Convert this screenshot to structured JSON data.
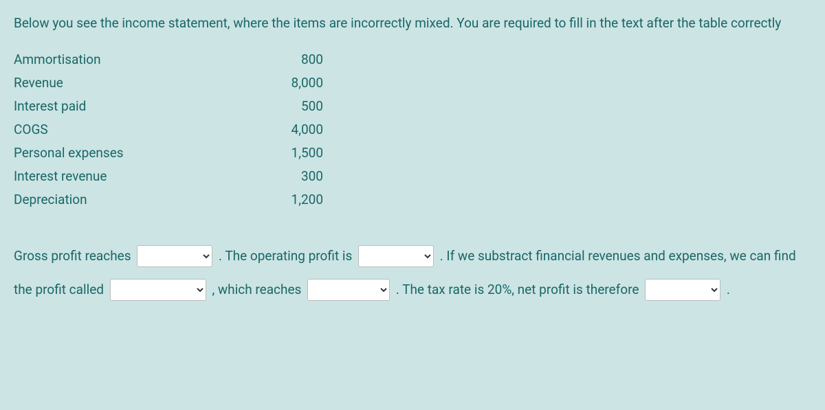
{
  "instructions": "Below you see the income statement, where the items are incorrectly mixed. You are required to fill in the text after the table correctly",
  "table_rows": [
    {
      "label": "Ammortisation",
      "value": "800"
    },
    {
      "label": "Revenue",
      "value": "8,000"
    },
    {
      "label": "Interest paid",
      "value": "500"
    },
    {
      "label": "COGS",
      "value": "4,000"
    },
    {
      "label": "Personal expenses",
      "value": "1,500"
    },
    {
      "label": "Interest revenue",
      "value": "300"
    },
    {
      "label": "Depreciation",
      "value": "1,200"
    }
  ],
  "fill": {
    "t1": "Gross profit reaches",
    "t2": ". The operating profit is",
    "t3": ". If we substract financial revenues and expenses, we can find the profit called",
    "t4": ", which reaches",
    "t5": ". The tax rate is 20%, net profit is therefore",
    "t6": "."
  }
}
